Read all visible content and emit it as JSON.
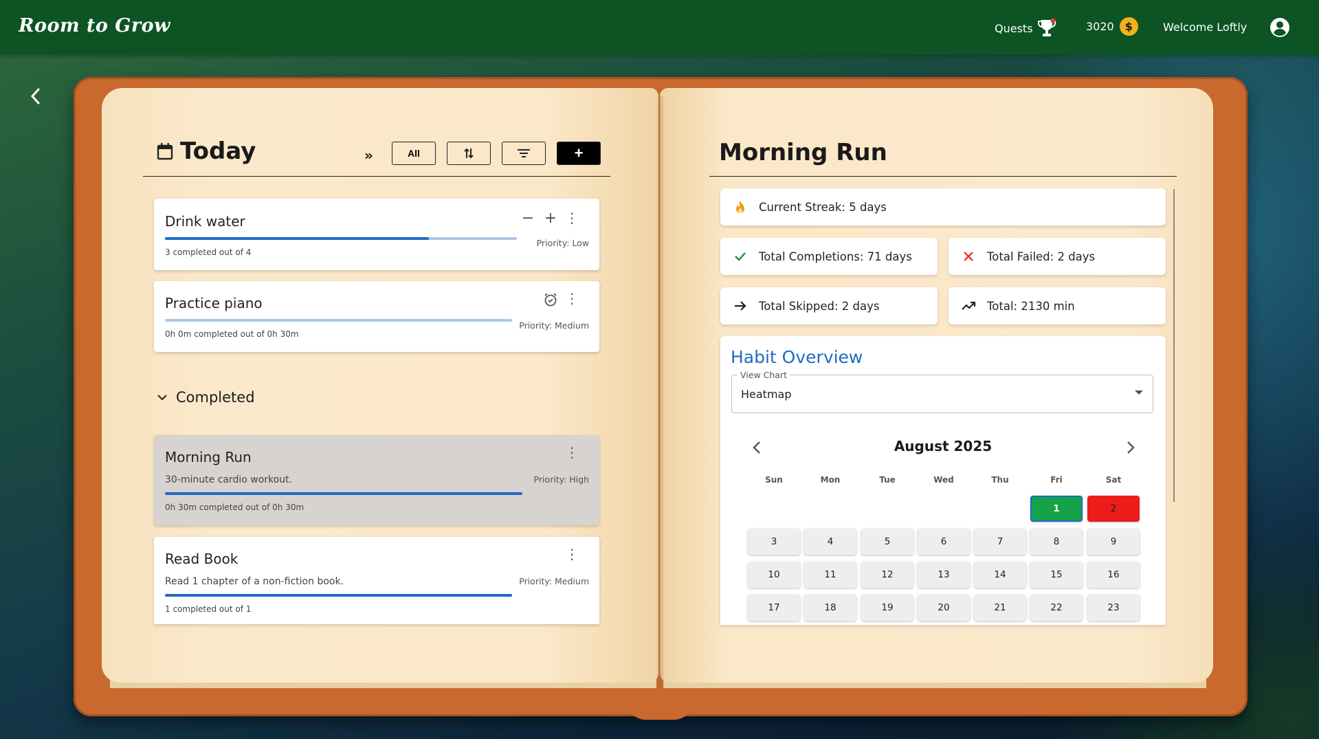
{
  "app": {
    "brand": "Room to Grow",
    "nav": {
      "quests_label": "Quests",
      "coins": "3020",
      "coin_symbol": "$",
      "welcome": "Welcome Loftly"
    }
  },
  "today": {
    "title": "Today",
    "filter_all_label": "All",
    "add_label": "+",
    "tasks": [
      {
        "title": "Drink water",
        "progress_text": "3 completed out of 4",
        "priority": "Priority: Low",
        "progress": 0.75
      },
      {
        "title": "Practice piano",
        "progress_text": "0h 0m completed out of 0h 30m",
        "priority": "Priority: Medium",
        "progress": 0.0
      }
    ],
    "completed_label": "Completed",
    "completed": [
      {
        "title": "Morning Run",
        "description": "30-minute cardio workout.",
        "progress_text": "0h 30m completed out of 0h 30m",
        "priority": "Priority: High",
        "progress": 1.0
      },
      {
        "title": "Read Book",
        "description": "Read 1 chapter of a non-fiction book.",
        "progress_text": "1 completed out of 1",
        "priority": "Priority: Medium",
        "progress": 1.0
      }
    ]
  },
  "detail": {
    "title": "Morning Run",
    "stats": {
      "streak": "Current Streak: 5 days",
      "completions": "Total Completions: 71 days",
      "failed": "Total Failed: 2 days",
      "skipped": "Total Skipped: 2 days",
      "total": "Total: 2130 min"
    },
    "overview": {
      "title": "Habit Overview",
      "view_label": "View Chart",
      "view_value": "Heatmap",
      "month": "August 2025",
      "weekdays": [
        "Sun",
        "Mon",
        "Tue",
        "Wed",
        "Thu",
        "Fri",
        "Sat"
      ],
      "days": [
        "1",
        "2",
        "3",
        "4",
        "5",
        "6",
        "7",
        "8",
        "9",
        "10",
        "11",
        "12",
        "13",
        "14",
        "15",
        "16",
        "17",
        "18",
        "19",
        "20",
        "21",
        "22",
        "23"
      ],
      "day_status": {
        "1": "completed",
        "2": "failed"
      }
    }
  },
  "colors": {
    "topbar": "#0d5424",
    "accent_blue": "#1f6bc4",
    "completed_green": "#15a34a",
    "failed_red": "#ee1b1b",
    "coin": "#f1b21a",
    "book_cover": "#c9692e",
    "page": "#fbe8c8"
  }
}
